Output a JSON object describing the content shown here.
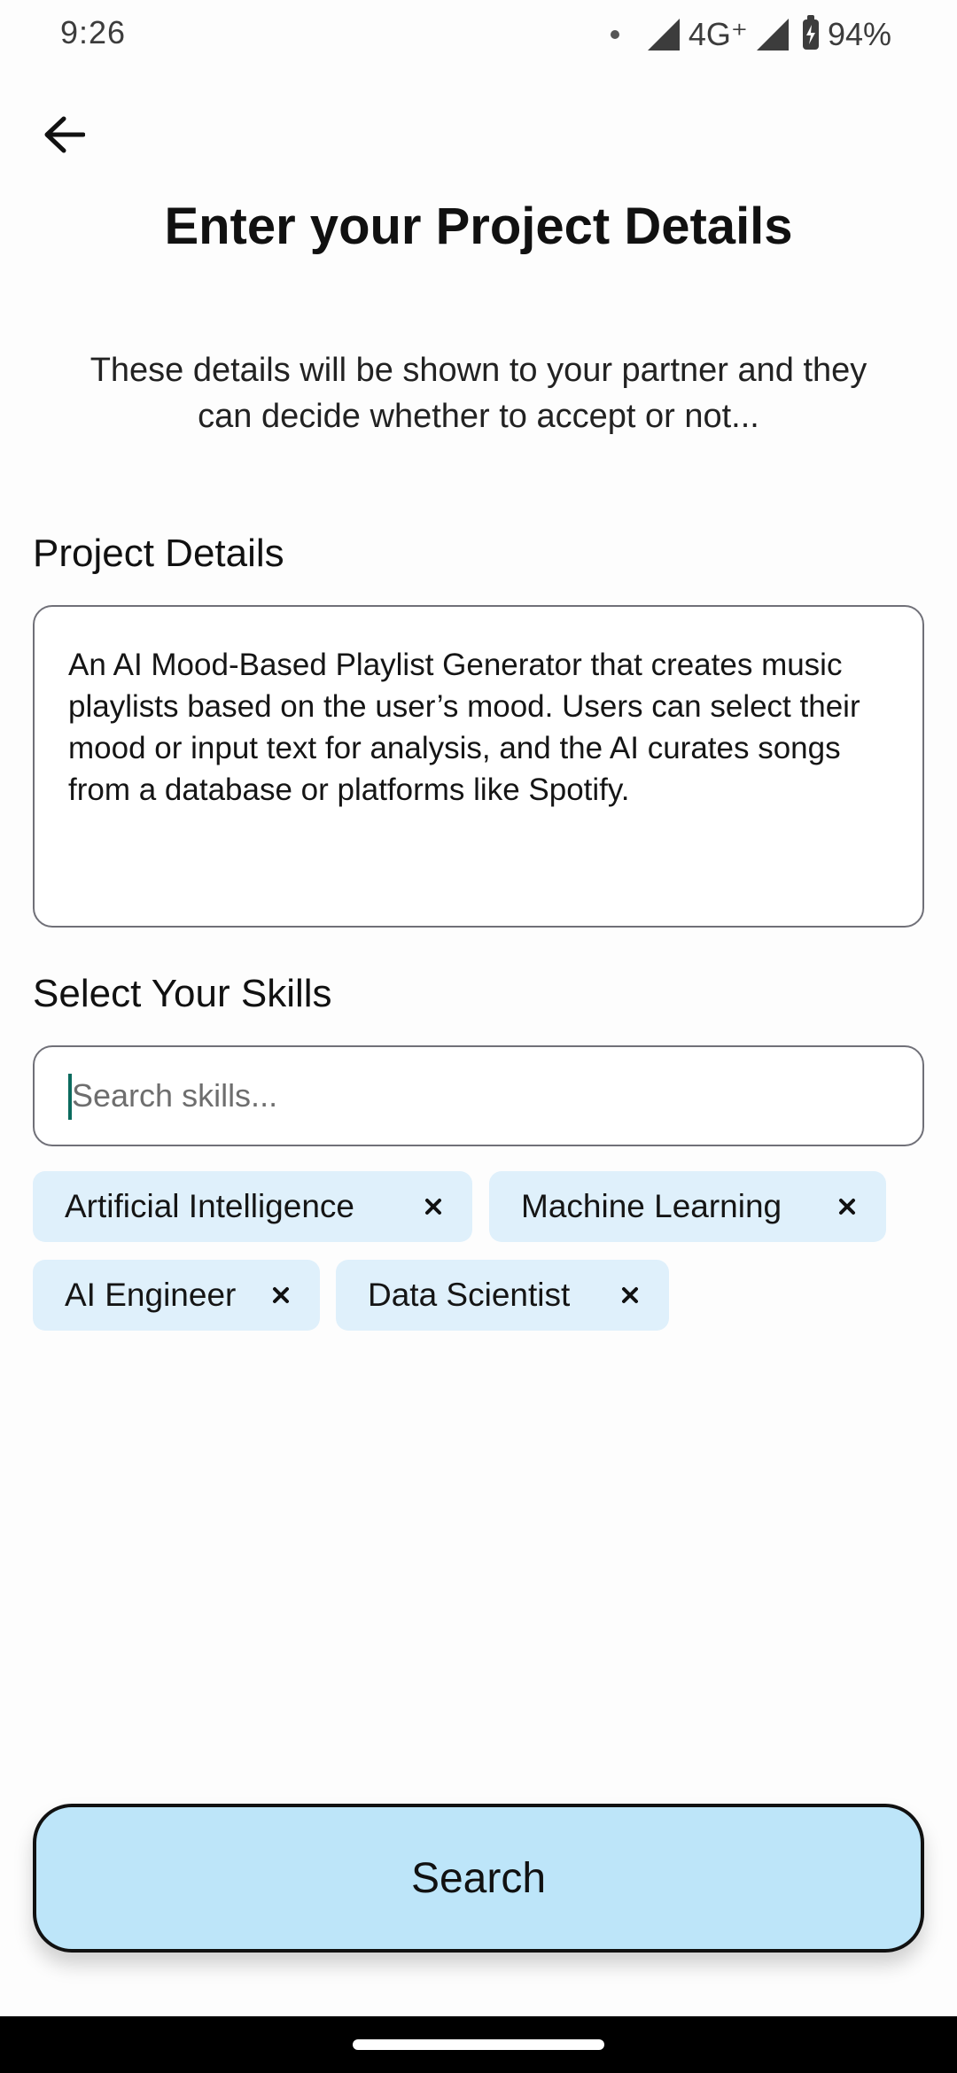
{
  "status_bar": {
    "time": "9:26",
    "network": "4G⁺",
    "battery": "94%"
  },
  "header": {
    "title": "Enter your Project Details",
    "subtitle": "These details will be shown to your partner and they can decide whether to accept or not..."
  },
  "details": {
    "label": "Project Details",
    "text": "An AI Mood-Based Playlist Generator that creates music playlists based on the user’s mood. Users can select their mood or input text for analysis, and the AI curates songs from a database or platforms like Spotify."
  },
  "skills": {
    "label": "Select Your Skills",
    "search_placeholder": "Search skills...",
    "selected": [
      {
        "label": "Artificial Intelligence"
      },
      {
        "label": "Machine Learning"
      },
      {
        "label": "AI Engineer"
      },
      {
        "label": "Data Scientist"
      }
    ]
  },
  "actions": {
    "search_label": "Search"
  },
  "colors": {
    "chip_bg": "#dff0fb",
    "button_bg": "#bde5f9",
    "caret": "#0b6b5e"
  }
}
